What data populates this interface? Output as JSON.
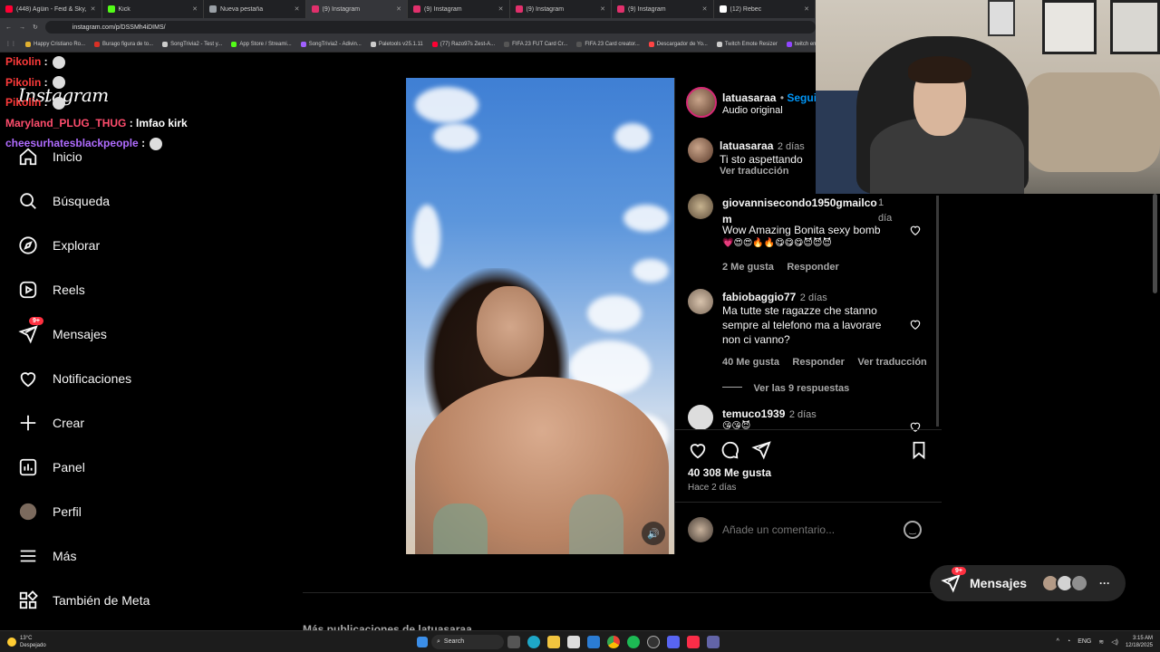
{
  "browser": {
    "tabs": [
      {
        "title": "(448) Agüin - Feid & Sky, Maj...",
        "color": "#ff0033"
      },
      {
        "title": "Kick",
        "color": "#53fc18"
      },
      {
        "title": "Nueva pestaña",
        "color": "#9aa0a6"
      },
      {
        "title": "(9) Instagram",
        "color": "#e1306c"
      },
      {
        "title": "(9) Instagram",
        "color": "#e1306c"
      },
      {
        "title": "(9) Instagram",
        "color": "#e1306c"
      },
      {
        "title": "(9) Instagram",
        "color": "#e1306c"
      },
      {
        "title": "(12) Rebec",
        "color": "#ffffff"
      }
    ],
    "url": "instagram.com/p/DSSMh4iDIMS/",
    "bookmarks": [
      {
        "label": "Happy Cristiano Ro...",
        "color": "#e0b030"
      },
      {
        "label": "Burago figura de to...",
        "color": "#d93025"
      },
      {
        "label": "SongTrivia2 - Test y...",
        "color": "#cccccc"
      },
      {
        "label": "App Store / Streami...",
        "color": "#53fc18"
      },
      {
        "label": "SongTrivia2 - Adivin...",
        "color": "#a060ff"
      },
      {
        "label": "Paletools v25.1.11",
        "color": "#cccccc"
      },
      {
        "label": "(77) Razo97s Zest-A...",
        "color": "#ff0033"
      },
      {
        "label": "FIFA 23 FUT Card Cr...",
        "color": "#555555"
      },
      {
        "label": "FIFA 23 Card creator...",
        "color": "#555555"
      },
      {
        "label": "Descargador de Yo...",
        "color": "#ff4444"
      },
      {
        "label": "Twitch Emote Resizer",
        "color": "#cccccc"
      },
      {
        "label": "twitch em",
        "color": "#9146ff"
      }
    ]
  },
  "chat": [
    {
      "user": "Pikolin",
      "msg": "",
      "color": "#ff3b3b"
    },
    {
      "user": "Pikolin",
      "msg": "",
      "color": "#ff3b3b"
    },
    {
      "user": "Pikolin",
      "msg": "",
      "color": "#ff3b3b"
    },
    {
      "user": "Maryland_PLUG_THUG",
      "msg": "lmfao kirk",
      "color": "#ff4d6d"
    },
    {
      "user": "cheesurhatesblackpeople",
      "msg": "",
      "color": "#b06cff"
    }
  ],
  "sidebar": {
    "logo": "Instagram",
    "items": [
      {
        "label": "Inicio",
        "icon": "home-icon"
      },
      {
        "label": "Búsqueda",
        "icon": "search-icon"
      },
      {
        "label": "Explorar",
        "icon": "compass-icon"
      },
      {
        "label": "Reels",
        "icon": "reels-icon"
      },
      {
        "label": "Mensajes",
        "icon": "messenger-icon",
        "badge": "9+"
      },
      {
        "label": "Notificaciones",
        "icon": "heart-icon"
      },
      {
        "label": "Crear",
        "icon": "plus-icon"
      },
      {
        "label": "Panel",
        "icon": "chart-icon"
      },
      {
        "label": "Perfil",
        "icon": "avatar-icon"
      },
      {
        "label": "Más",
        "icon": "menu-icon"
      },
      {
        "label": "También de Meta",
        "icon": "meta-icon"
      }
    ]
  },
  "post": {
    "author": "latuasaraa",
    "follow": "Seguir",
    "audio": "Audio original",
    "caption": {
      "user": "latuasaraa",
      "time": "2 días",
      "text": "Ti sto aspettando",
      "translate": "Ver traducción"
    },
    "comments": [
      {
        "user": "giovannisecondo1950gmailco",
        "user2": "m",
        "time": "1",
        "time2": "día",
        "text": "Wow Amazing Bonita sexy bomb",
        "emojis": "💗😍😍🔥🔥😋😋😋😈😈😈",
        "likes": "2 Me gusta",
        "reply": "Responder"
      },
      {
        "user": "fabiobaggio77",
        "time": "2 días",
        "text": "Ma tutte ste ragazze che stanno sempre al telefono ma a lavorare non ci vanno?",
        "likes": "40 Me gusta",
        "reply": "Responder",
        "translate": "Ver traducción",
        "replies": "Ver las 9 respuestas"
      },
      {
        "user": "temuco1939",
        "time": "2 días",
        "text": "😘😘😈"
      }
    ],
    "likes": "40 308 Me gusta",
    "date": "Hace 2 días",
    "comment_placeholder": "Añade un comentario..."
  },
  "messages_pill": {
    "label": "Mensajes",
    "badge": "9+"
  },
  "bottom_text": "Más publicaciones de latuasaraa",
  "taskbar": {
    "weather_temp": "13°C",
    "weather_desc": "Despejado",
    "search": "Search",
    "lang": "ENG",
    "time": "3:15 AM",
    "date": "12/18/2025"
  }
}
